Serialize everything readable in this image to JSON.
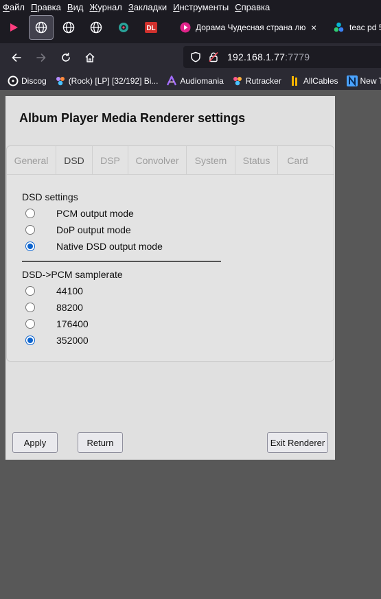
{
  "menubar": {
    "items": [
      {
        "hot": "Ф",
        "rest": "айл"
      },
      {
        "hot": "П",
        "rest": "равка"
      },
      {
        "hot": "В",
        "rest": "ид"
      },
      {
        "hot": "Ж",
        "rest": "урнал"
      },
      {
        "hot": "З",
        "rest": "акладки"
      },
      {
        "hot": "И",
        "rest": "нструменты"
      },
      {
        "hot": "С",
        "rest": "правка"
      }
    ]
  },
  "tabbar": {
    "tab1_title": "Дорама Чудесная страна люб",
    "tab2_title": "teac pd 5",
    "pinned_badge": "DL"
  },
  "navbar": {
    "url_host": "192.168.1.77",
    "url_port": ":7779"
  },
  "bookmarks": [
    {
      "label": "Discog",
      "icon": "vinyl-icon",
      "color": "#ffffff"
    },
    {
      "label": "(Rock) [LP] [32/192] Bi...",
      "icon": "rutracker-icon",
      "color": "#b48cff"
    },
    {
      "label": "Audiomania",
      "icon": "audiomania-icon",
      "color": "#a36bff"
    },
    {
      "label": "Rutracker",
      "icon": "rutracker-icon",
      "color": "#ff5a8a"
    },
    {
      "label": "AllCables",
      "icon": "allcables-icon",
      "color": "#f5b400"
    },
    {
      "label": "New Te",
      "icon": "n-icon",
      "color": "#4aa3ff"
    }
  ],
  "page": {
    "title": "Album Player Media Renderer settings",
    "tabs": [
      {
        "label": "General",
        "selected": false
      },
      {
        "label": "DSD",
        "selected": true
      },
      {
        "label": "DSP",
        "selected": false
      },
      {
        "label": "Convolver",
        "selected": false
      },
      {
        "label": "System",
        "selected": false
      },
      {
        "label": "Status",
        "selected": false
      },
      {
        "label": "Card",
        "selected": false
      }
    ],
    "dsd_settings_label": "DSD settings",
    "dsd_modes": [
      {
        "label": "PCM output mode",
        "checked": false
      },
      {
        "label": "DoP output mode",
        "checked": false
      },
      {
        "label": "Native DSD output mode",
        "checked": true
      }
    ],
    "samplerate_label": "DSD->PCM samplerate",
    "samplerates": [
      {
        "label": "44100",
        "checked": false
      },
      {
        "label": "88200",
        "checked": false
      },
      {
        "label": "176400",
        "checked": false
      },
      {
        "label": "352000",
        "checked": true
      }
    ],
    "buttons": {
      "apply": "Apply",
      "return": "Return",
      "exit": "Exit Renderer"
    }
  },
  "colors": {
    "chrome_dark": "#1c1b22",
    "chrome_toolbar": "#2b2a33",
    "radio_accent": "#0b63ce",
    "page_bg": "#e0e0e0"
  }
}
